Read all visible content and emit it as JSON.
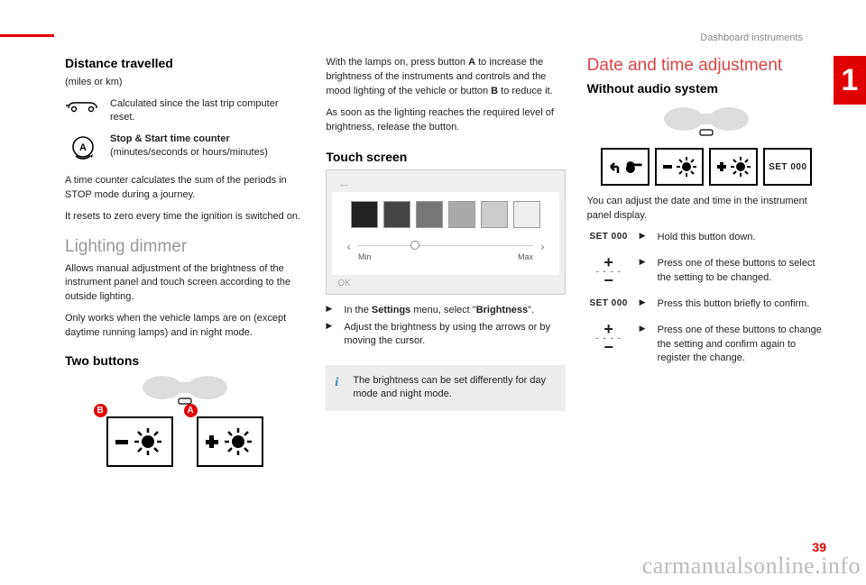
{
  "header": {
    "section": "Dashboard instruments",
    "chapter": "1",
    "page": "39"
  },
  "watermark": "carmanualsonline.info",
  "col1": {
    "distance_heading": "Distance travelled",
    "distance_units": "(miles or km)",
    "distance_desc": "Calculated since the last trip computer reset.",
    "stopstart_title": "Stop & Start time counter",
    "stopstart_units": "(minutes/seconds or hours/minutes)",
    "time_counter_p1": "A time counter calculates the sum of the periods in STOP mode during a journey.",
    "time_counter_p2": "It resets to zero every time the ignition is switched on.",
    "lighting_heading": "Lighting dimmer",
    "lighting_p1": "Allows manual adjustment of the brightness of the instrument panel and touch screen according to the outside lighting.",
    "lighting_p2": "Only works when the vehicle lamps are on (except daytime running lamps) and in night mode.",
    "two_buttons_heading": "Two buttons",
    "badge_b": "B",
    "badge_a": "A"
  },
  "col2": {
    "intro_p1_a": "With the lamps on, press button ",
    "intro_p1_bold_a": "A",
    "intro_p1_b": " to increase the brightness of the instruments and controls and the mood lighting of the vehicle or button ",
    "intro_p1_bold_b": "B",
    "intro_p1_c": " to reduce it.",
    "intro_p2": "As soon as the lighting reaches the required level of brightness, release the button.",
    "touch_heading": "Touch screen",
    "ts_min": "Min",
    "ts_max": "Max",
    "ts_ok": "OK",
    "bullet_sym": "▶",
    "bullet1_a": "In the ",
    "bullet1_bold1": "Settings",
    "bullet1_b": " menu, select \"",
    "bullet1_bold2": "Brightness",
    "bullet1_c": "\".",
    "bullet2": "Adjust the brightness by using the arrows or by moving the cursor.",
    "info": "The brightness can be set differently for day mode and night mode."
  },
  "col3": {
    "date_heading": "Date and time adjustment",
    "without_heading": "Without audio system",
    "set_label": "SET  000",
    "intro": "You can adjust the date and time in the instrument panel display.",
    "step_sym": "▶",
    "step1": "Hold this button down.",
    "step2": "Press one of these buttons to select the setting to be changed.",
    "step3": "Press this button briefly to confirm.",
    "step4": "Press one of these buttons to change the setting and confirm again to register the change."
  }
}
